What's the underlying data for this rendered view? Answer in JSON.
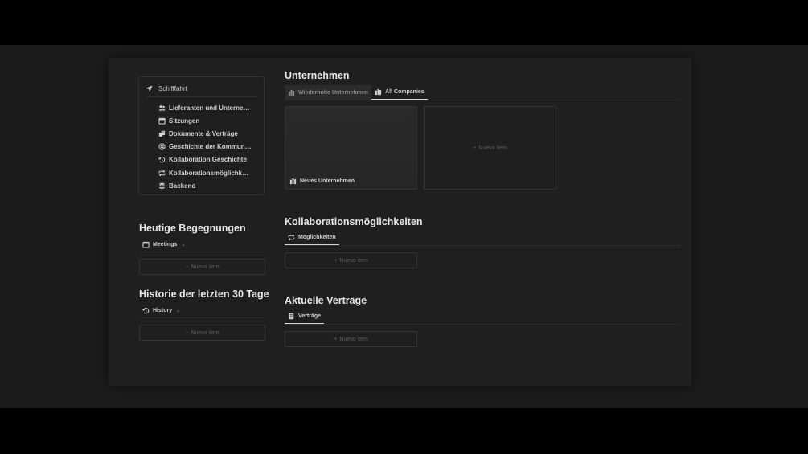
{
  "navigation": {
    "title": "Schifffahrt",
    "items": [
      {
        "label": "Lieferanten und Unterne…",
        "icon": "people-icon"
      },
      {
        "label": "Sitzungen",
        "icon": "calendar-icon"
      },
      {
        "label": "Dokumente & Verträge",
        "icon": "documents-icon"
      },
      {
        "label": "Geschichte der Kommun…",
        "icon": "at-icon"
      },
      {
        "label": "Kollaboration Geschichte",
        "icon": "history-icon"
      },
      {
        "label": "Kollaborationsmöglichk…",
        "icon": "repeat-icon"
      },
      {
        "label": "Backend",
        "icon": "database-icon"
      }
    ]
  },
  "today": {
    "heading": "Heutige Begegnungen",
    "view_label": "Meetings",
    "new_item": "Nuevo item"
  },
  "history": {
    "heading": "Historie der letzten 30 Tage",
    "view_label": "History",
    "new_item": "Nuevo item"
  },
  "companies": {
    "heading": "Unternehmen",
    "tabs": [
      "Wiederholte Unternehmen",
      "All Companies"
    ],
    "active_tab": "All Companies",
    "card_title": "Neues Unternehmen",
    "new_item": "Nuevo item"
  },
  "collab": {
    "heading": "Kollaborationsmöglichkeiten",
    "tab": "Möglichkeiten",
    "new_item": "Nuevo item"
  },
  "contracts": {
    "heading": "Aktuelle Verträge",
    "tab": "Verträge",
    "new_item": "Nuevo item"
  }
}
